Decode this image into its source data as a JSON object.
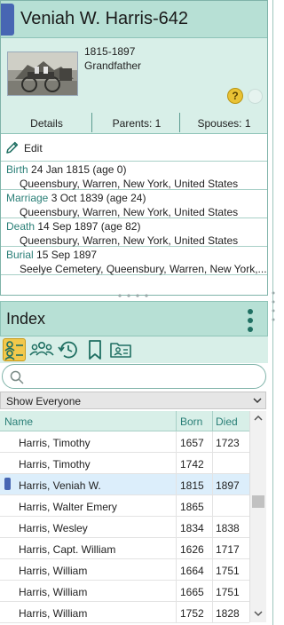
{
  "person": {
    "name": "Veniah W. Harris-642",
    "lifespan": "1815-1897",
    "relation": "Grandfather",
    "hint_icon": "?",
    "tabs": [
      {
        "label": "Details"
      },
      {
        "label": "Parents: 1"
      },
      {
        "label": "Spouses: 1"
      }
    ],
    "edit_label": "Edit",
    "events": [
      {
        "type": "Birth",
        "date": "24 Jan 1815 (age 0)",
        "place": "Queensbury, Warren, New York, United States"
      },
      {
        "type": "Marriage",
        "date": "3 Oct 1839 (age 24)",
        "place": "Queensbury, Warren, New York, United States"
      },
      {
        "type": "Death",
        "date": "14 Sep 1897 (age 82)",
        "place": "Queensbury, Warren, New York, United States"
      },
      {
        "type": "Burial",
        "date": "15 Sep 1897",
        "place": "Seelye Cemetery, Queensbury, Warren, New York,..."
      }
    ]
  },
  "index": {
    "title": "Index",
    "toolbar_icons": [
      "people-list-icon",
      "family-group-icon",
      "history-icon",
      "bookmark-icon",
      "folder-person-icon"
    ],
    "search": {
      "value": "",
      "placeholder": ""
    },
    "filter_selected": "Show Everyone",
    "columns": {
      "name": "Name",
      "born": "Born",
      "died": "Died"
    },
    "rows": [
      {
        "name": "Harris, Timothy",
        "born": "1657",
        "died": "1723",
        "selected": false
      },
      {
        "name": "Harris, Timothy",
        "born": "1742",
        "died": "",
        "selected": false
      },
      {
        "name": "Harris, Veniah W.",
        "born": "1815",
        "died": "1897",
        "selected": true
      },
      {
        "name": "Harris, Walter Emery",
        "born": "1865",
        "died": "",
        "selected": false
      },
      {
        "name": "Harris, Wesley",
        "born": "1834",
        "died": "1838",
        "selected": false
      },
      {
        "name": "Harris, Capt. William",
        "born": "1626",
        "died": "1717",
        "selected": false
      },
      {
        "name": "Harris, William",
        "born": "1664",
        "died": "1751",
        "selected": false
      },
      {
        "name": "Harris, William",
        "born": "1665",
        "died": "1751",
        "selected": false
      },
      {
        "name": "Harris, William",
        "born": "1752",
        "died": "1828",
        "selected": false
      }
    ]
  },
  "colors": {
    "header_teal": "#b7e0d5",
    "panel_teal": "#d8efe8",
    "accent_blue": "#4766b3",
    "event_label": "#2a7f77",
    "active_tool": "#f2c84b"
  }
}
